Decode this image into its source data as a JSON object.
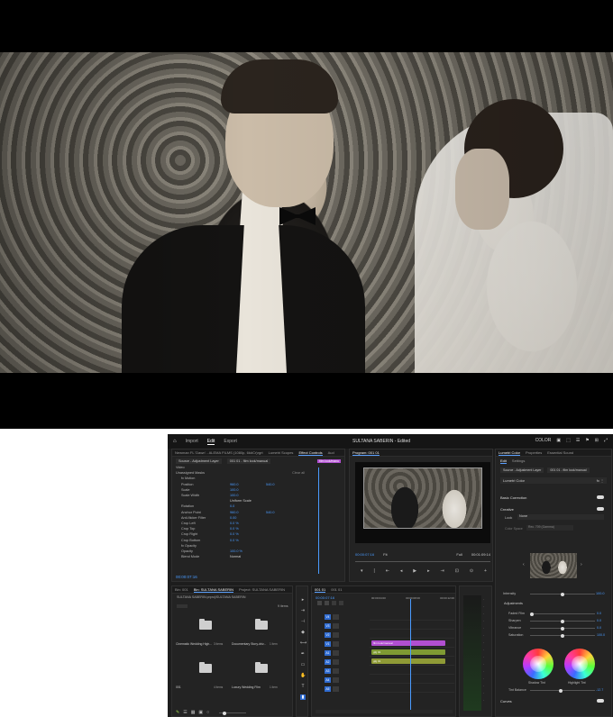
{
  "topbar": {
    "home": "⌂",
    "nav": [
      "Import",
      "Edit",
      "Export"
    ],
    "active_nav": "Edit",
    "title": "SULTANA SABERIN - Edited",
    "right": [
      "COLOR",
      "▣",
      "⬚",
      "☰",
      "⚑",
      "⊞",
      "⤢"
    ]
  },
  "effect_controls": {
    "tabs": [
      "Newman FL 'Dawn' - ALEMA FILMS (1080p, 6k#Cr)rgrt",
      "Lumetri Scopes",
      "Effect Controls",
      "Aud"
    ],
    "active_tab": "Effect Controls",
    "breadcrumb_left": "Source - Adjustment Layer",
    "breadcrumb_right": "001 01 - film look/manual",
    "clip_label": "film look/manu",
    "section_video": "Video",
    "section_masks": "Unassigned Masks",
    "clear_all": "Clear all",
    "rows": [
      {
        "label": "fx  Motion",
        "v1": "",
        "v2": ""
      },
      {
        "label": "Position",
        "v1": "960.0",
        "v2": "540.0"
      },
      {
        "label": "Scale",
        "v1": "100.0",
        "v2": ""
      },
      {
        "label": "Scale Width",
        "v1": "100.0",
        "v2": ""
      },
      {
        "label": "",
        "v1": "Uniform Scale",
        "v2": ""
      },
      {
        "label": "Rotation",
        "v1": "0.0",
        "v2": ""
      },
      {
        "label": "Anchor Point",
        "v1": "960.0",
        "v2": "540.0"
      },
      {
        "label": "Anti-flicker Filter",
        "v1": "0.00",
        "v2": ""
      },
      {
        "label": "Crop Left",
        "v1": "0.0 %",
        "v2": ""
      },
      {
        "label": "Crop Top",
        "v1": "0.0 %",
        "v2": ""
      },
      {
        "label": "Crop Right",
        "v1": "0.0 %",
        "v2": ""
      },
      {
        "label": "Crop Bottom",
        "v1": "0.0 %",
        "v2": ""
      },
      {
        "label": "fx  Opacity",
        "v1": "",
        "v2": ""
      },
      {
        "label": "Opacity",
        "v1": "100.0 %",
        "v2": ""
      },
      {
        "label": "Blend Mode",
        "v1": "Normal",
        "v2": ""
      }
    ],
    "timecode": "00:00:07:16"
  },
  "program": {
    "title": "Program: 001 01",
    "timecode": "00:00:07:16",
    "fit": "Fit",
    "quality": "Full",
    "duration": "00:01:09:14"
  },
  "lumetri": {
    "tabs": [
      "Lumetri Color",
      "Properties",
      "Essential Sound"
    ],
    "active_tab": "Lumetri Color",
    "subtabs": [
      "Edit",
      "Settings"
    ],
    "source": "Source - Adjustment Layer",
    "clip": "001 01 - film look/manual",
    "preset": "Lumetri Color",
    "basic_correction": "Basic Correction",
    "creative": "Creative",
    "look_label": "Look",
    "look_value": "None",
    "color_space_label": "Color Space",
    "color_space_value": "Rec. 709 (Gamma)",
    "intensity_label": "Intensity",
    "intensity_value": "100.0",
    "adjustments": "Adjustments",
    "sliders": [
      {
        "label": "Faded Film",
        "value": "0.0",
        "pos": 0.0
      },
      {
        "label": "Sharpen",
        "value": "0.0",
        "pos": 0.5
      },
      {
        "label": "Vibrance",
        "value": "0.0",
        "pos": 0.5
      },
      {
        "label": "Saturation",
        "value": "100.0",
        "pos": 0.5
      }
    ],
    "shadow_tint": "Shadow Tint",
    "highlight_tint": "Highlight Tint",
    "tint_balance_label": "Tint Balance",
    "tint_balance_value": "-12.7",
    "curves": "Curves"
  },
  "project": {
    "tabs": [
      "Bin: 001",
      "Bin: SULTANA SABERIN",
      "Project: SULTANA SABERIN"
    ],
    "active_tab": "Bin: SULTANA SABERIN",
    "path": "SULTANA SABERIN.prproj\\SULTANA SABERIN",
    "count": "9 items",
    "bins": [
      {
        "name": "Cinematic Wedding High...",
        "items": "3 items"
      },
      {
        "name": "Documentary Story-driv...",
        "items": "1 item"
      },
      {
        "name": "001",
        "items": "4 items"
      },
      {
        "name": "Luxury Wedding Film",
        "items": "1 item"
      }
    ]
  },
  "timeline": {
    "tab": "001 01",
    "tab2": "001 01",
    "timecode": "00:00:07:16",
    "ruler": [
      "00:00:04:00",
      "00:00:08:00",
      "00:00:12:00"
    ],
    "tracks": [
      "V4",
      "V3",
      "V2",
      "V1",
      "A1",
      "A2",
      "A3",
      "A4",
      "A5"
    ],
    "clips": [
      {
        "name": "film look/manual",
        "color": "#b14fd1"
      },
      {
        "name": "gfg 01",
        "color": "#8fa93a"
      },
      {
        "name": "gfg 01",
        "color": "#9aa63e"
      }
    ]
  },
  "colors": {
    "accent": "#4a9bff",
    "panel": "#232323",
    "bg": "#1d1d1d"
  }
}
